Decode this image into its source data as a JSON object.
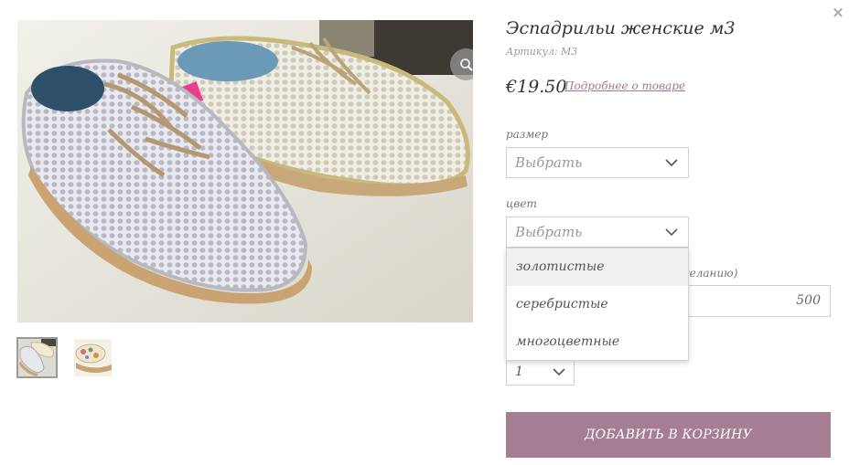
{
  "product": {
    "title": "Эспадрильи женские м3",
    "sku": "Артикул: М3",
    "price": "€19.50",
    "details_link": "Подробнее о товаре"
  },
  "options": {
    "size_label": "размер",
    "size_value": "Выбрать",
    "color_label": "цвет",
    "color_value": "Выбрать",
    "color_choices": [
      "золотистые",
      "серебристые",
      "многоцветные"
    ],
    "amount_label_fragment": "желанию)",
    "amount_value": "500",
    "quantity_value": "1"
  },
  "actions": {
    "add_to_cart": "ДОБАВИТЬ В КОРЗИНУ",
    "close_symbol": "×"
  },
  "colors": {
    "accent": "#a57e93",
    "link": "#a07a90",
    "border": "#cfcfcf"
  },
  "icons": {
    "close": "close-icon",
    "zoom": "magnifier-icon",
    "dropdown": "chevron-down-icon"
  }
}
